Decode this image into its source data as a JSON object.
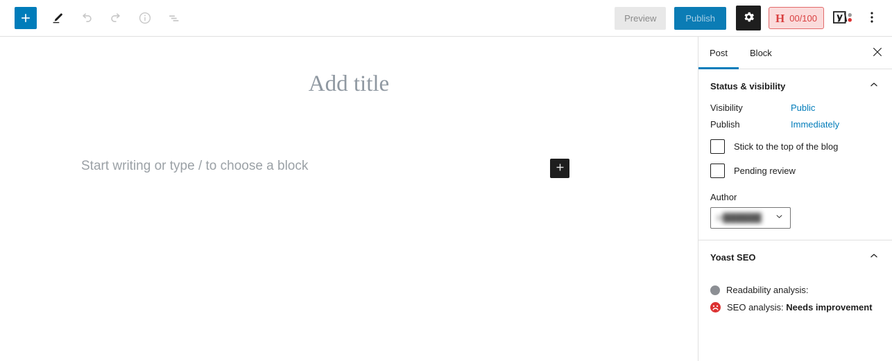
{
  "toolbar": {
    "add_block_label": "+",
    "tools": [
      {
        "name": "tools-pencil",
        "title": "Tools"
      },
      {
        "name": "undo",
        "title": "Undo"
      },
      {
        "name": "redo",
        "title": "Redo"
      },
      {
        "name": "details",
        "title": "Details"
      },
      {
        "name": "list-view",
        "title": "List view"
      }
    ],
    "preview_label": "Preview",
    "publish_label": "Publish",
    "settings_title": "Settings",
    "hemingway": {
      "letter": "H",
      "score": "00/100",
      "border_color": "#e26a6a",
      "bg_color": "#fadbdb",
      "text_color": "#d94040"
    },
    "yoast_title": "Yoast SEO",
    "options_title": "Options"
  },
  "editor": {
    "title_placeholder": "Add title",
    "body_placeholder": "Start writing or type / to choose a block",
    "inline_inserter_label": "+"
  },
  "sidebar": {
    "tabs": [
      {
        "label": "Post",
        "active": true
      },
      {
        "label": "Block",
        "active": false
      }
    ],
    "close_label": "×",
    "status_panel": {
      "title": "Status & visibility",
      "visibility_label": "Visibility",
      "visibility_value": "Public",
      "publish_label": "Publish",
      "publish_value": "Immediately",
      "sticky_label": "Stick to the top of the blog",
      "pending_label": "Pending review",
      "author_label": "Author",
      "author_value": "H██████"
    },
    "yoast_panel": {
      "title": "Yoast SEO",
      "readability_label": "Readability analysis:",
      "readability_value": "",
      "seo_label": "SEO analysis:",
      "seo_value": "Needs improvement"
    }
  },
  "colors": {
    "accent_blue": "#007cba",
    "publish_blue": "#0b7cb5",
    "dark": "#1e1e1e",
    "border": "#e0e0e0",
    "seo_red": "#dc3232",
    "readability_gray": "#8c8f94"
  }
}
